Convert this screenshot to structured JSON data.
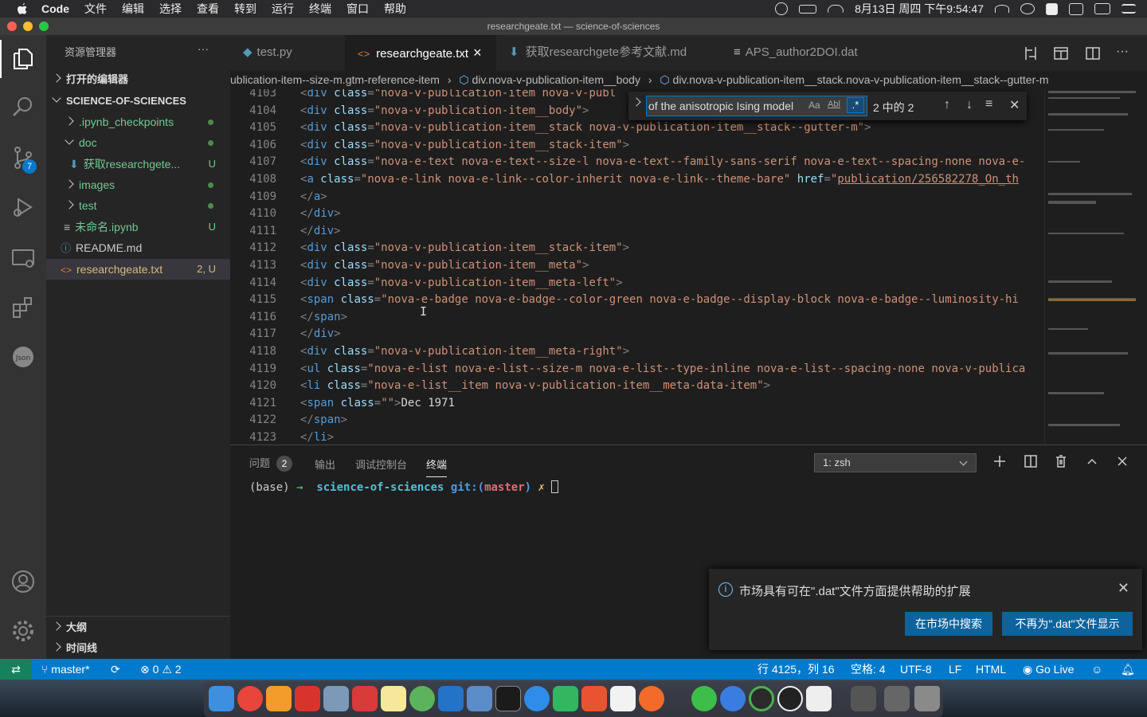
{
  "menubar": {
    "app": "Code",
    "items": [
      "文件",
      "编辑",
      "选择",
      "查看",
      "转到",
      "运行",
      "终端",
      "窗口",
      "帮助"
    ],
    "clock": "8月13日 周四 下午9:54:47"
  },
  "window": {
    "title": "researchgeate.txt — science-of-sciences"
  },
  "sidebar": {
    "title": "资源管理器",
    "more": "···",
    "open_editors": "打开的编辑器",
    "project": "SCIENCE-OF-SCIENCES",
    "items": [
      {
        "label": ".ipynb_checkpoints",
        "status": ""
      },
      {
        "label": "doc",
        "status": ""
      },
      {
        "label": "获取researchgete...",
        "status": "U"
      },
      {
        "label": "images",
        "status": ""
      },
      {
        "label": "test",
        "status": ""
      },
      {
        "label": "未命名.ipynb",
        "status": "U"
      },
      {
        "label": "README.md",
        "status": ""
      },
      {
        "label": "researchgeate.txt",
        "status": "2, U"
      }
    ],
    "outline": "大纲",
    "timeline": "时间线"
  },
  "tabs": [
    {
      "label": "test.py"
    },
    {
      "label": "researchgeate.txt",
      "close": "×"
    },
    {
      "label": "获取researchgete参考文献.md"
    },
    {
      "label": "APS_author2DOI.dat"
    }
  ],
  "breadcrumb": {
    "part1": "ublication-item--size-m.gtm-reference-item",
    "part2": "div.nova-v-publication-item__body",
    "part3": "div.nova-v-publication-item__stack.nova-v-publication-item__stack--gutter-m"
  },
  "find": {
    "query": "of the anisotropic Ising model",
    "case": "Aa",
    "word": "Abl",
    "regex": ".*",
    "count": "2 中的 2"
  },
  "editor": {
    "lines": [
      {
        "n": "4103",
        "t": [
          [
            "o",
            "<"
          ],
          [
            "tag",
            "div "
          ],
          [
            "attr",
            "class"
          ],
          [
            "o",
            "="
          ],
          [
            "str",
            "\"nova-v-publication-item nova-v-publ"
          ]
        ]
      },
      {
        "n": "4104",
        "t": [
          [
            "o",
            "<"
          ],
          [
            "tag",
            "div "
          ],
          [
            "attr",
            "class"
          ],
          [
            "o",
            "="
          ],
          [
            "str",
            "\"nova-v-publication-item__body\""
          ],
          [
            "o",
            ">"
          ]
        ]
      },
      {
        "n": "4105",
        "t": [
          [
            "o",
            "<"
          ],
          [
            "tag",
            "div "
          ],
          [
            "attr",
            "class"
          ],
          [
            "o",
            "="
          ],
          [
            "str",
            "\"nova-v-publication-item__stack nova-v-publication-item__stack--gutter-m\""
          ],
          [
            "o",
            ">"
          ]
        ]
      },
      {
        "n": "4106",
        "t": [
          [
            "o",
            "<"
          ],
          [
            "tag",
            "div "
          ],
          [
            "attr",
            "class"
          ],
          [
            "o",
            "="
          ],
          [
            "str",
            "\"nova-v-publication-item__stack-item\""
          ],
          [
            "o",
            ">"
          ]
        ]
      },
      {
        "n": "4107",
        "t": [
          [
            "o",
            "<"
          ],
          [
            "tag",
            "div "
          ],
          [
            "attr",
            "class"
          ],
          [
            "o",
            "="
          ],
          [
            "str",
            "\"nova-e-text nova-e-text--size-l nova-e-text--family-sans-serif nova-e-text--spacing-none nova-e-"
          ]
        ]
      },
      {
        "n": "4108",
        "t": [
          [
            "o",
            "<"
          ],
          [
            "tag",
            "a "
          ],
          [
            "attr",
            "class"
          ],
          [
            "o",
            "="
          ],
          [
            "str",
            "\"nova-e-link nova-e-link--color-inherit nova-e-link--theme-bare\" "
          ],
          [
            "attr",
            "href"
          ],
          [
            "o",
            "="
          ],
          [
            "str",
            "\""
          ],
          [
            "lnk",
            "publication/256582278_On_th"
          ]
        ]
      },
      {
        "n": "4109",
        "t": [
          [
            "o",
            "</"
          ],
          [
            "tag",
            "a"
          ],
          [
            "o",
            ">"
          ]
        ]
      },
      {
        "n": "4110",
        "t": [
          [
            "o",
            "</"
          ],
          [
            "tag",
            "div"
          ],
          [
            "o",
            ">"
          ]
        ]
      },
      {
        "n": "4111",
        "t": [
          [
            "o",
            "</"
          ],
          [
            "tag",
            "div"
          ],
          [
            "o",
            ">"
          ]
        ]
      },
      {
        "n": "4112",
        "t": [
          [
            "o",
            "<"
          ],
          [
            "tag",
            "div "
          ],
          [
            "attr",
            "class"
          ],
          [
            "o",
            "="
          ],
          [
            "str",
            "\"nova-v-publication-item__stack-item\""
          ],
          [
            "o",
            ">"
          ]
        ]
      },
      {
        "n": "4113",
        "t": [
          [
            "o",
            "<"
          ],
          [
            "tag",
            "div "
          ],
          [
            "attr",
            "class"
          ],
          [
            "o",
            "="
          ],
          [
            "str",
            "\"nova-v-publication-item__meta\""
          ],
          [
            "o",
            ">"
          ]
        ]
      },
      {
        "n": "4114",
        "t": [
          [
            "o",
            "<"
          ],
          [
            "tag",
            "div "
          ],
          [
            "attr",
            "class"
          ],
          [
            "o",
            "="
          ],
          [
            "str",
            "\"nova-v-publication-item__meta-left\""
          ],
          [
            "o",
            ">"
          ]
        ]
      },
      {
        "n": "4115",
        "t": [
          [
            "o",
            "<"
          ],
          [
            "tag",
            "span "
          ],
          [
            "attr",
            "class"
          ],
          [
            "o",
            "="
          ],
          [
            "str",
            "\"nova-e-badge nova-e-badge--color-green nova-e-badge--display-block nova-e-badge--luminosity-hi"
          ]
        ]
      },
      {
        "n": "4116",
        "t": [
          [
            "o",
            "</"
          ],
          [
            "tag",
            "span"
          ],
          [
            "o",
            ">"
          ]
        ]
      },
      {
        "n": "4117",
        "t": [
          [
            "o",
            "</"
          ],
          [
            "tag",
            "div"
          ],
          [
            "o",
            ">"
          ]
        ]
      },
      {
        "n": "4118",
        "t": [
          [
            "o",
            "<"
          ],
          [
            "tag",
            "div "
          ],
          [
            "attr",
            "class"
          ],
          [
            "o",
            "="
          ],
          [
            "str",
            "\"nova-v-publication-item__meta-right\""
          ],
          [
            "o",
            ">"
          ]
        ]
      },
      {
        "n": "4119",
        "t": [
          [
            "o",
            "<"
          ],
          [
            "tag",
            "ul "
          ],
          [
            "attr",
            "class"
          ],
          [
            "o",
            "="
          ],
          [
            "str",
            "\"nova-e-list nova-e-list--size-m nova-e-list--type-inline nova-e-list--spacing-none nova-v-publica"
          ]
        ]
      },
      {
        "n": "4120",
        "t": [
          [
            "o",
            "<"
          ],
          [
            "tag",
            "li "
          ],
          [
            "attr",
            "class"
          ],
          [
            "o",
            "="
          ],
          [
            "str",
            "\"nova-e-list__item nova-v-publication-item__meta-data-item\""
          ],
          [
            "o",
            ">"
          ]
        ]
      },
      {
        "n": "4121",
        "t": [
          [
            "o",
            "<"
          ],
          [
            "tag",
            "span "
          ],
          [
            "attr",
            "class"
          ],
          [
            "o",
            "="
          ],
          [
            "str",
            "\"\""
          ],
          [
            "o",
            ">"
          ],
          [
            "txt",
            "Dec 1971"
          ]
        ]
      },
      {
        "n": "4122",
        "t": [
          [
            "o",
            "</"
          ],
          [
            "tag",
            "span"
          ],
          [
            "o",
            ">"
          ]
        ]
      },
      {
        "n": "4123",
        "t": [
          [
            "o",
            "</"
          ],
          [
            "tag",
            "li"
          ],
          [
            "o",
            ">"
          ]
        ]
      }
    ]
  },
  "panel": {
    "tabs": [
      {
        "label": "问题",
        "badge": "2"
      },
      {
        "label": "输出"
      },
      {
        "label": "调试控制台"
      },
      {
        "label": "终端"
      }
    ],
    "terminal_select": "1: zsh",
    "prompt_env": "(base)",
    "prompt_arrow": "→",
    "prompt_dir": "science-of-sciences",
    "prompt_git": "git:(",
    "prompt_branch": "master",
    "prompt_git_end": ")",
    "prompt_mark": "✗"
  },
  "notification": {
    "message": "市场具有可在\".dat\"文件方面提供帮助的扩展",
    "btn_search": "在市场中搜索",
    "btn_dismiss": "不再为\".dat\"文件显示"
  },
  "status": {
    "branch": "master*",
    "errors": "0",
    "warnings": "2",
    "position": "行 4125，列 16",
    "spaces": "空格: 4",
    "encoding": "UTF-8",
    "eol": "LF",
    "language": "HTML",
    "golive": "Go Live"
  },
  "colors": {
    "accent": "#007acc",
    "button": "#0e639c",
    "modified": "#d7ba7d",
    "untracked": "#73c991"
  }
}
